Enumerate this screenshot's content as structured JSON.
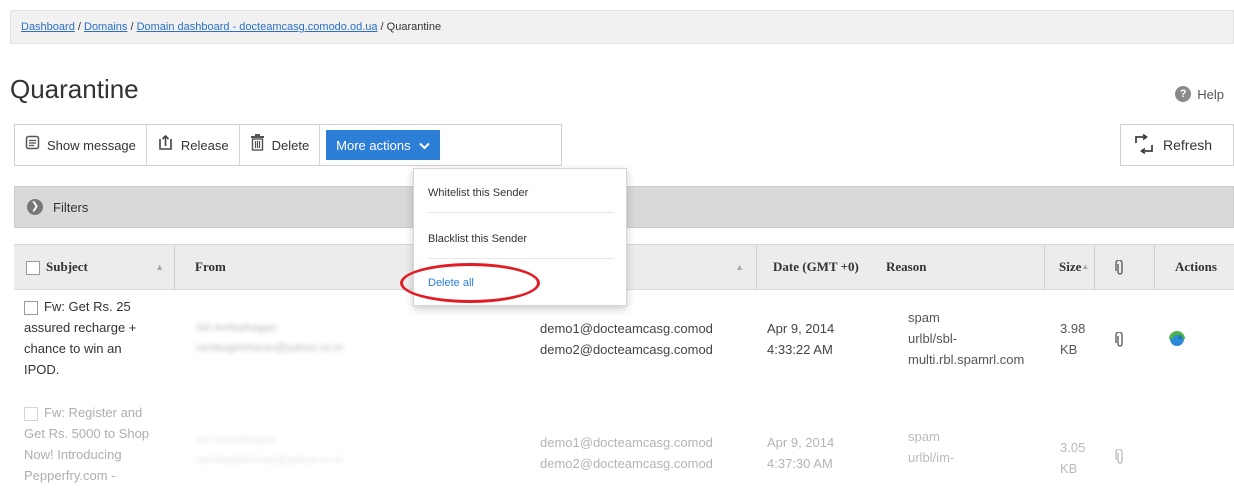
{
  "breadcrumb": {
    "dashboard": "Dashboard",
    "sep": " / ",
    "domains": "Domains",
    "domain_dashboard": "Domain dashboard - docteamcasg.comodo.od.ua",
    "current": "Quarantine"
  },
  "page_title": "Quarantine",
  "help_label": "Help",
  "toolbar": {
    "show_message": "Show message",
    "release": "Release",
    "delete": "Delete",
    "more_actions": "More actions",
    "refresh": "Refresh"
  },
  "filters_label": "Filters",
  "dropdown": {
    "whitelist": "Whitelist this Sender",
    "blacklist": "Blacklist this Sender",
    "delete_all": "Delete all"
  },
  "columns": {
    "subject": "Subject",
    "from": "From",
    "date": "Date (GMT +0)",
    "reason": "Reason",
    "size": "Size",
    "actions": "Actions"
  },
  "rows": [
    {
      "subject": [
        "Fw: Get Rs. 25",
        "assured recharge +",
        "chance to win an",
        "IPOD."
      ],
      "from": [
        "Siri Ambathagan",
        "rambugirisharan@yahoo.co.in"
      ],
      "to": [
        "demo1@docteamcasg.comod",
        "demo2@docteamcasg.comod"
      ],
      "date": [
        "Apr 9, 2014",
        "4:33:22 AM"
      ],
      "reason": [
        "spam",
        "urlbl/sbl-",
        "multi.rbl.spamrl.com"
      ],
      "size": [
        "3.98",
        "KB"
      ]
    },
    {
      "subject": [
        "Fw: Register and",
        "Get Rs. 5000 to Shop",
        "Now! Introducing",
        "Pepperfry.com -"
      ],
      "from": [
        "Siri Ambathagan",
        "rambugirisharan@yahoo.co.in"
      ],
      "to": [
        "demo1@docteamcasg.comod",
        "demo2@docteamcasg.comod"
      ],
      "date": [
        "Apr 9, 2014",
        "4:37:30 AM"
      ],
      "reason": [
        "spam",
        "urlbl/im-"
      ],
      "size": [
        "3.05",
        "KB"
      ]
    }
  ],
  "colors": {
    "accent": "#2d7ed6",
    "highlight": "#e21c24",
    "link": "#2a6fc9"
  }
}
